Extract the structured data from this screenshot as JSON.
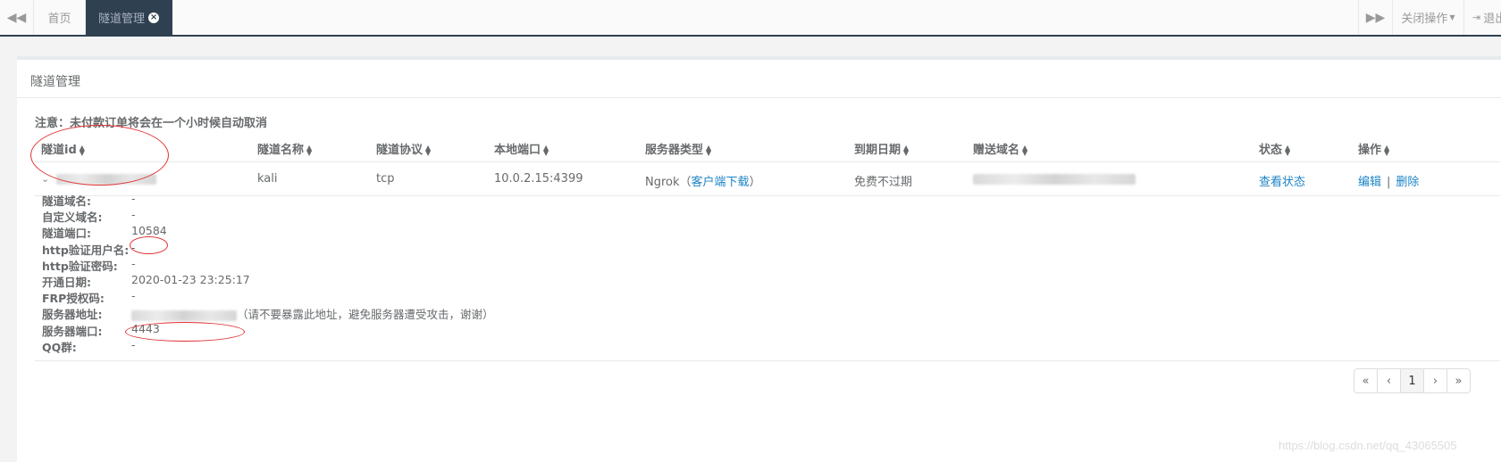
{
  "tabs": {
    "prev_icon": "backward-icon",
    "home_label": "首页",
    "active_label": "隧道管理",
    "next_icon": "forward-icon",
    "close_ops_label": "关闭操作",
    "logout_label": "退出"
  },
  "panel": {
    "title": "隧道管理",
    "notice": "注意：未付款订单将会在一个小时候自动取消"
  },
  "table": {
    "headers": [
      "隧道id",
      "隧道名称",
      "隧道协议",
      "本地端口",
      "服务器类型",
      "到期日期",
      "赠送域名",
      "状态",
      "操作"
    ],
    "row": {
      "name": "kali",
      "protocol": "tcp",
      "local_port": "10.0.2.15:4399",
      "server_type": "Ngrok",
      "client_download_open": "（",
      "client_download": "客户端下载",
      "client_download_close": "）",
      "expire": "免费不过期",
      "status_link": "查看状态",
      "edit": "编辑",
      "separator": "|",
      "delete": "删除"
    }
  },
  "details": [
    {
      "label": "隧道域名:",
      "value": "-"
    },
    {
      "label": "自定义域名:",
      "value": "-"
    },
    {
      "label": "隧道端口:",
      "value": "10584"
    },
    {
      "label": "http验证用户名:",
      "value": "-"
    },
    {
      "label": "http验证密码:",
      "value": "-"
    },
    {
      "label": "开通日期:",
      "value": "2020-01-23 23:25:17"
    },
    {
      "label": "FRP授权码:",
      "value": "-"
    },
    {
      "label": "服务器地址:",
      "value": "（请不要暴露此地址，避免服务器遭受攻击，谢谢）"
    },
    {
      "label": "服务器端口:",
      "value": "4443"
    },
    {
      "label": "QQ群:",
      "value": "-"
    }
  ],
  "pagination": [
    "«",
    "‹",
    "1",
    "›",
    "»"
  ],
  "watermark": "https://blog.csdn.net/qq_43065505",
  "colors": {
    "dark_nav": "#2f4050",
    "link": "#1c84c6",
    "annotation": "#e03030"
  }
}
